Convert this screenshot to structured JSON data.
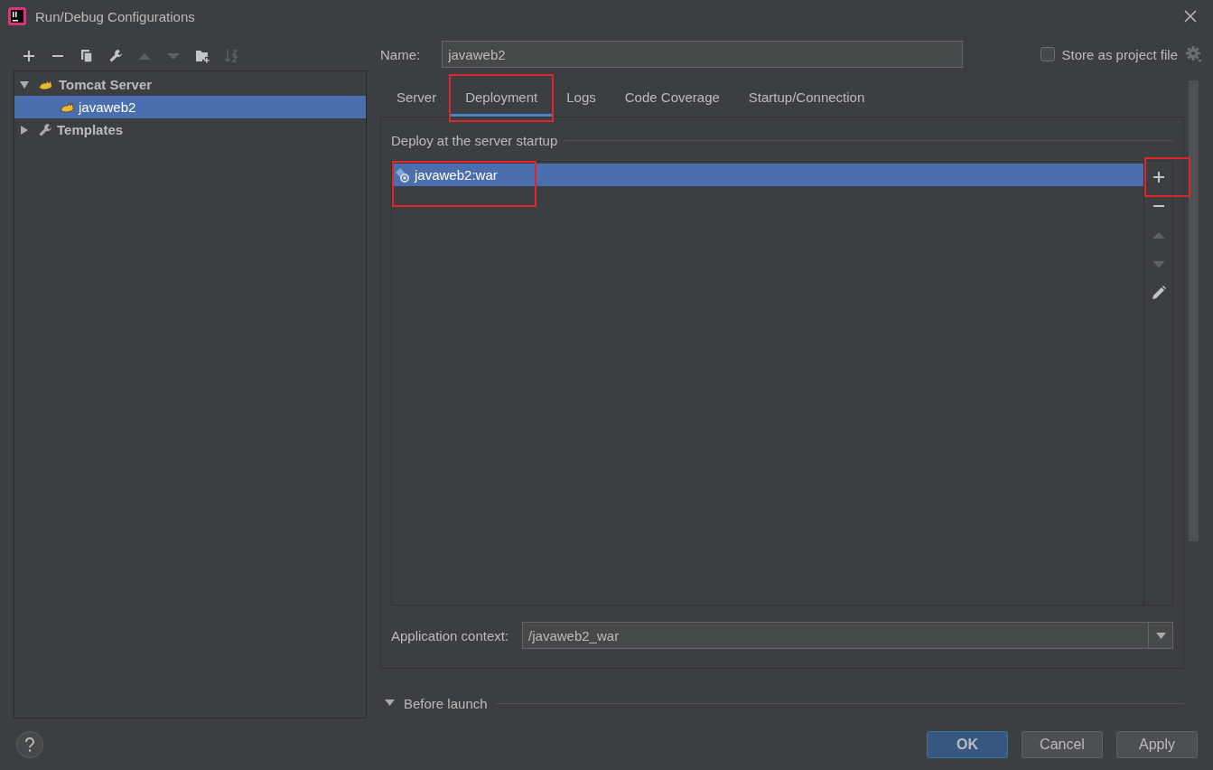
{
  "window": {
    "title": "Run/Debug Configurations"
  },
  "toolbar": [
    {
      "kind": "add",
      "disabled": false
    },
    {
      "kind": "remove",
      "disabled": false
    },
    {
      "kind": "copy",
      "disabled": false
    },
    {
      "kind": "wrench",
      "disabled": false
    },
    {
      "kind": "up",
      "disabled": true
    },
    {
      "kind": "down",
      "disabled": true
    },
    {
      "kind": "folder",
      "disabled": false
    },
    {
      "kind": "sort",
      "disabled": true
    }
  ],
  "tree": [
    {
      "label": "Tomcat Server",
      "kind": "tomcat",
      "expanded": true,
      "selected": false,
      "children": [
        {
          "label": "javaweb2",
          "kind": "tomcat",
          "selected": true
        }
      ]
    },
    {
      "label": "Templates",
      "kind": "wrench",
      "expanded": false,
      "selected": false
    }
  ],
  "name": {
    "label": "Name:",
    "value": "javaweb2"
  },
  "store_as_project_file": {
    "label": "Store as project file",
    "checked": false
  },
  "tabs": [
    {
      "label": "Server",
      "selected": false,
      "highlighted": false
    },
    {
      "label": "Deployment",
      "selected": true,
      "highlighted": true
    },
    {
      "label": "Logs",
      "selected": false,
      "highlighted": false
    },
    {
      "label": "Code Coverage",
      "selected": false,
      "highlighted": false
    },
    {
      "label": "Startup/Connection",
      "selected": false,
      "highlighted": false
    }
  ],
  "deployment": {
    "title": "Deploy at the server startup",
    "artifacts": [
      {
        "label": "javaweb2:war",
        "selected": true,
        "highlighted": true
      }
    ],
    "side_toolbar": [
      {
        "kind": "add",
        "disabled": false,
        "highlighted": true
      },
      {
        "kind": "remove",
        "disabled": false,
        "highlighted": false
      },
      {
        "kind": "up",
        "disabled": true,
        "highlighted": false
      },
      {
        "kind": "down",
        "disabled": true,
        "highlighted": false
      },
      {
        "kind": "edit",
        "disabled": false,
        "highlighted": false
      }
    ],
    "context": {
      "label": "Application context:",
      "value": "/javaweb2_war"
    }
  },
  "before_launch": {
    "label": "Before launch",
    "expanded": true
  },
  "buttons": [
    {
      "label": "OK",
      "default": true
    },
    {
      "label": "Cancel",
      "default": false
    },
    {
      "label": "Apply",
      "default": false
    }
  ]
}
